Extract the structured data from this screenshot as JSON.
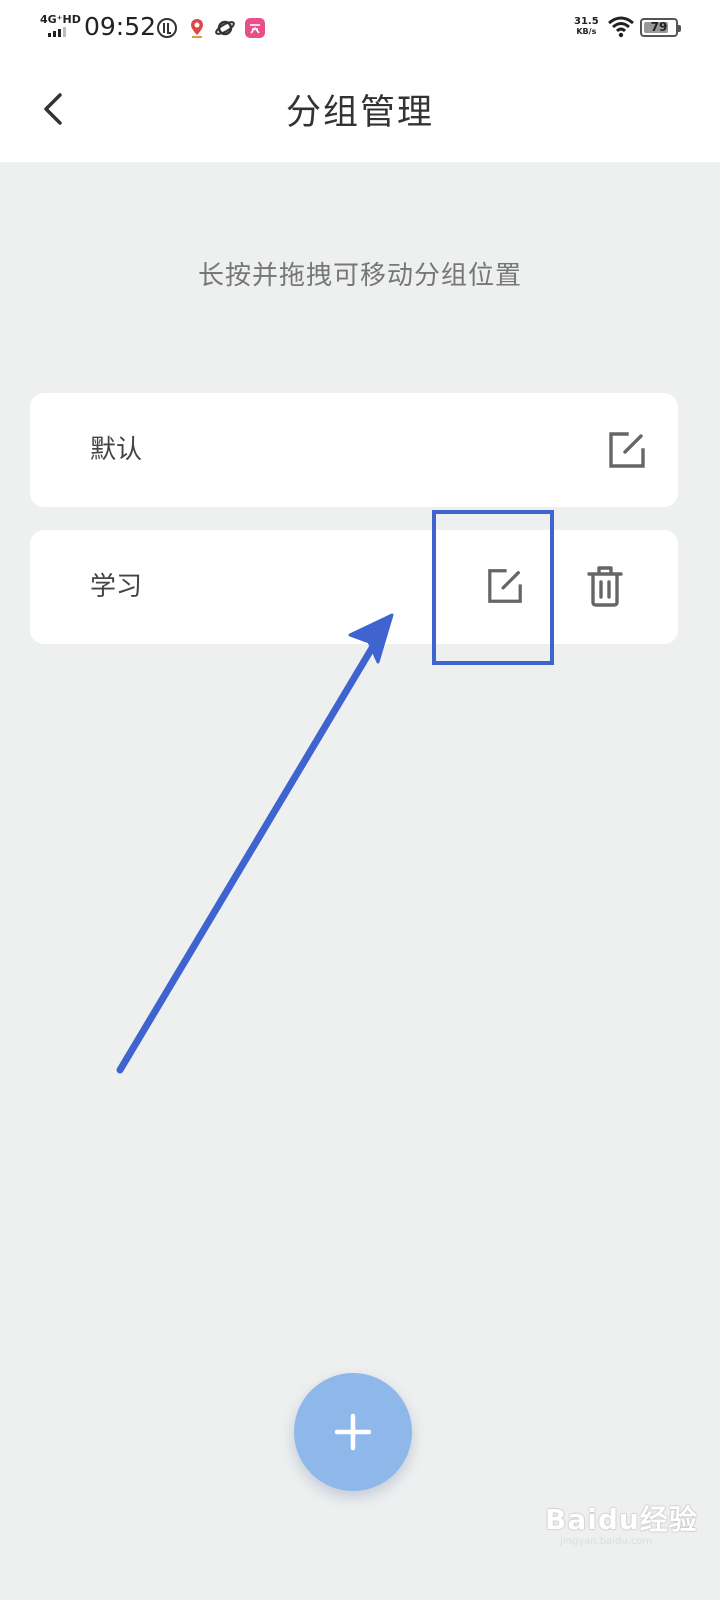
{
  "status_bar": {
    "network": "4G⁺HD",
    "time": "09:52",
    "speed_value": "31.5",
    "speed_unit": "KB/s",
    "battery": "79",
    "battery_level": 0.79
  },
  "header": {
    "title": "分组管理",
    "back_icon": "chevron-left-icon"
  },
  "hint": "长按并拖拽可移动分组位置",
  "groups": [
    {
      "name": "默认",
      "actions": [
        "edit-icon"
      ]
    },
    {
      "name": "学习",
      "actions": [
        "edit-icon",
        "trash-icon"
      ]
    }
  ],
  "fab": {
    "icon": "plus-icon"
  },
  "watermark": {
    "text": "Baidu经验",
    "sub": "jingyan.baidu.com"
  },
  "colors": {
    "background": "#eef0f0",
    "card": "#ffffff",
    "fab": "#8fb8ea",
    "annotation": "#3f63cf",
    "icon": "#666666"
  }
}
